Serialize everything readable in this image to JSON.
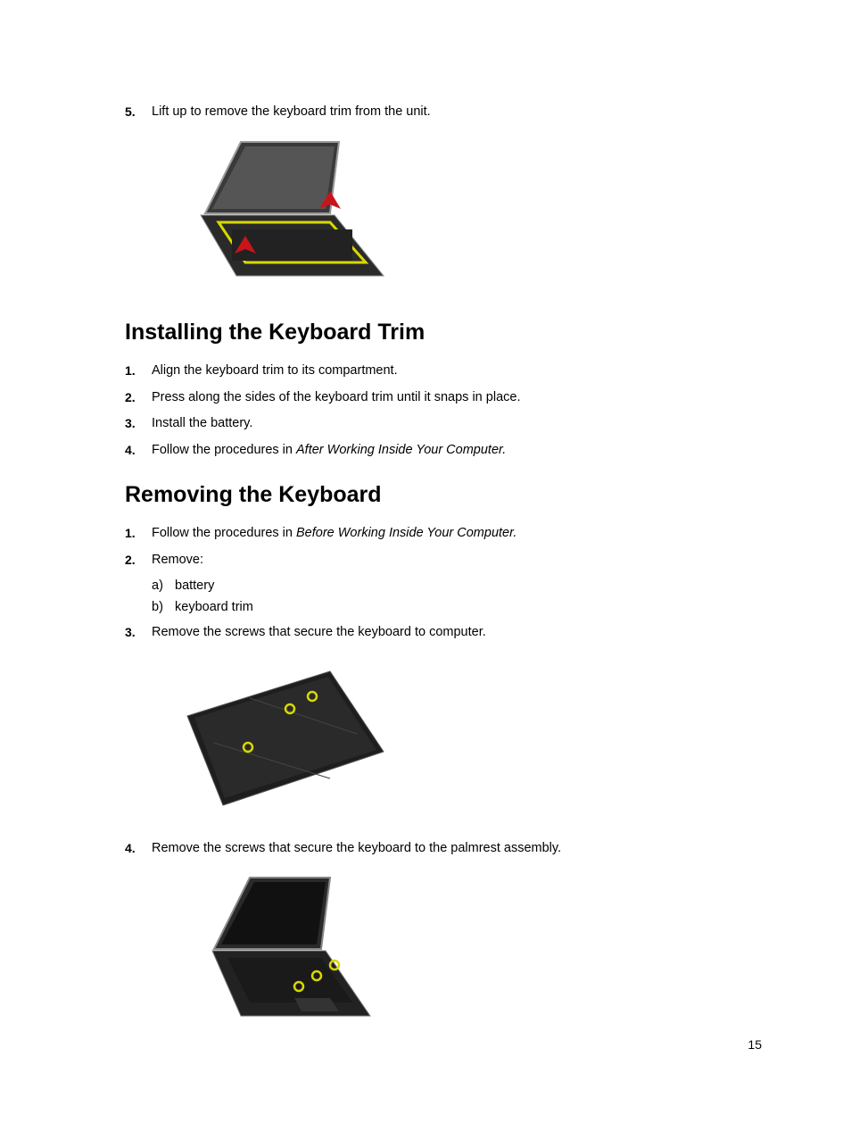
{
  "step5": {
    "num": "5.",
    "text": "Lift up to remove the keyboard trim from the unit."
  },
  "heading1": "Installing the Keyboard Trim",
  "install": {
    "s1": {
      "num": "1.",
      "text": "Align the keyboard trim to its compartment."
    },
    "s2": {
      "num": "2.",
      "text": "Press along the sides of the keyboard trim until it snaps in place."
    },
    "s3": {
      "num": "3.",
      "text": "Install the battery."
    },
    "s4": {
      "num": "4.",
      "prefix": "Follow the procedures in ",
      "italic": "After Working Inside Your Computer."
    }
  },
  "heading2": "Removing the Keyboard",
  "remove": {
    "s1": {
      "num": "1.",
      "prefix": "Follow the procedures in ",
      "italic": "Before Working Inside Your Computer."
    },
    "s2": {
      "num": "2.",
      "text": "Remove:"
    },
    "s2a": {
      "letter": "a)",
      "text": "battery"
    },
    "s2b": {
      "letter": "b)",
      "text": "keyboard trim"
    },
    "s3": {
      "num": "3.",
      "text": "Remove the screws that secure the keyboard to computer."
    },
    "s4": {
      "num": "4.",
      "text": "Remove the screws that secure the keyboard to the palmrest assembly."
    }
  },
  "pageNumber": "15"
}
